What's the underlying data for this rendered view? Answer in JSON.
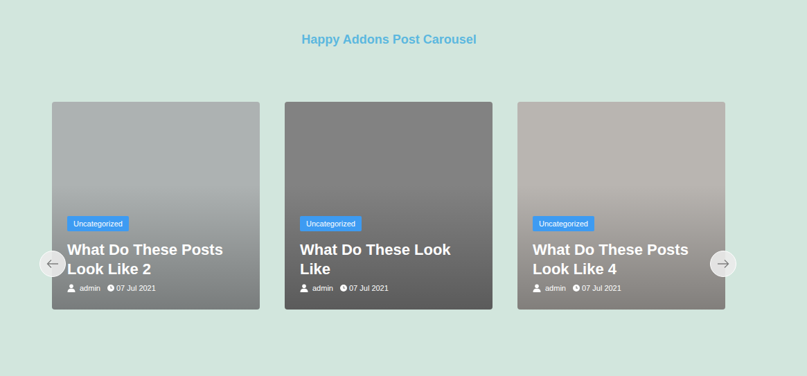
{
  "title": "Happy Addons Post Carousel",
  "posts": [
    {
      "category": "Uncategorized",
      "title": "What Do These Posts Look Like 2",
      "author": "admin",
      "date": "07 Jul 2021"
    },
    {
      "category": "Uncategorized",
      "title": "What Do These Look Like",
      "author": "admin",
      "date": "07 Jul 2021"
    },
    {
      "category": "Uncategorized",
      "title": "What Do These Posts Look Like 4",
      "author": "admin",
      "date": "07 Jul 2021"
    }
  ]
}
